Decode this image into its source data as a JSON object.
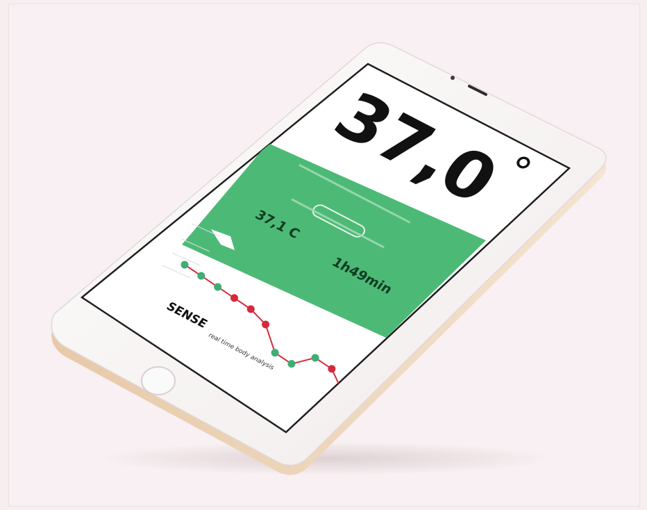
{
  "app": {
    "temperature_display": "37,0",
    "degree_symbol": "°",
    "avg_value": "37,1 C",
    "duration_value": "1h49min",
    "brand_name": "SENSE",
    "tagline": "real time body analysis"
  },
  "chart_data": {
    "type": "line",
    "x": [
      1,
      2,
      3,
      4,
      5,
      6,
      7,
      8,
      9,
      10,
      11
    ],
    "series": [
      {
        "values": [
          36.6,
          36.55,
          36.5,
          36.45,
          36.4,
          36.3,
          36.05,
          36.0,
          36.15,
          36.1,
          35.9
        ]
      }
    ],
    "point_status": [
      "normal",
      "normal",
      "normal",
      "high",
      "high",
      "high",
      "normal",
      "normal",
      "normal",
      "high",
      "high"
    ],
    "colors": {
      "normal": "#3fae72",
      "high": "#d6293d",
      "line": "#d6293d",
      "header_green": "#4cba76"
    }
  }
}
